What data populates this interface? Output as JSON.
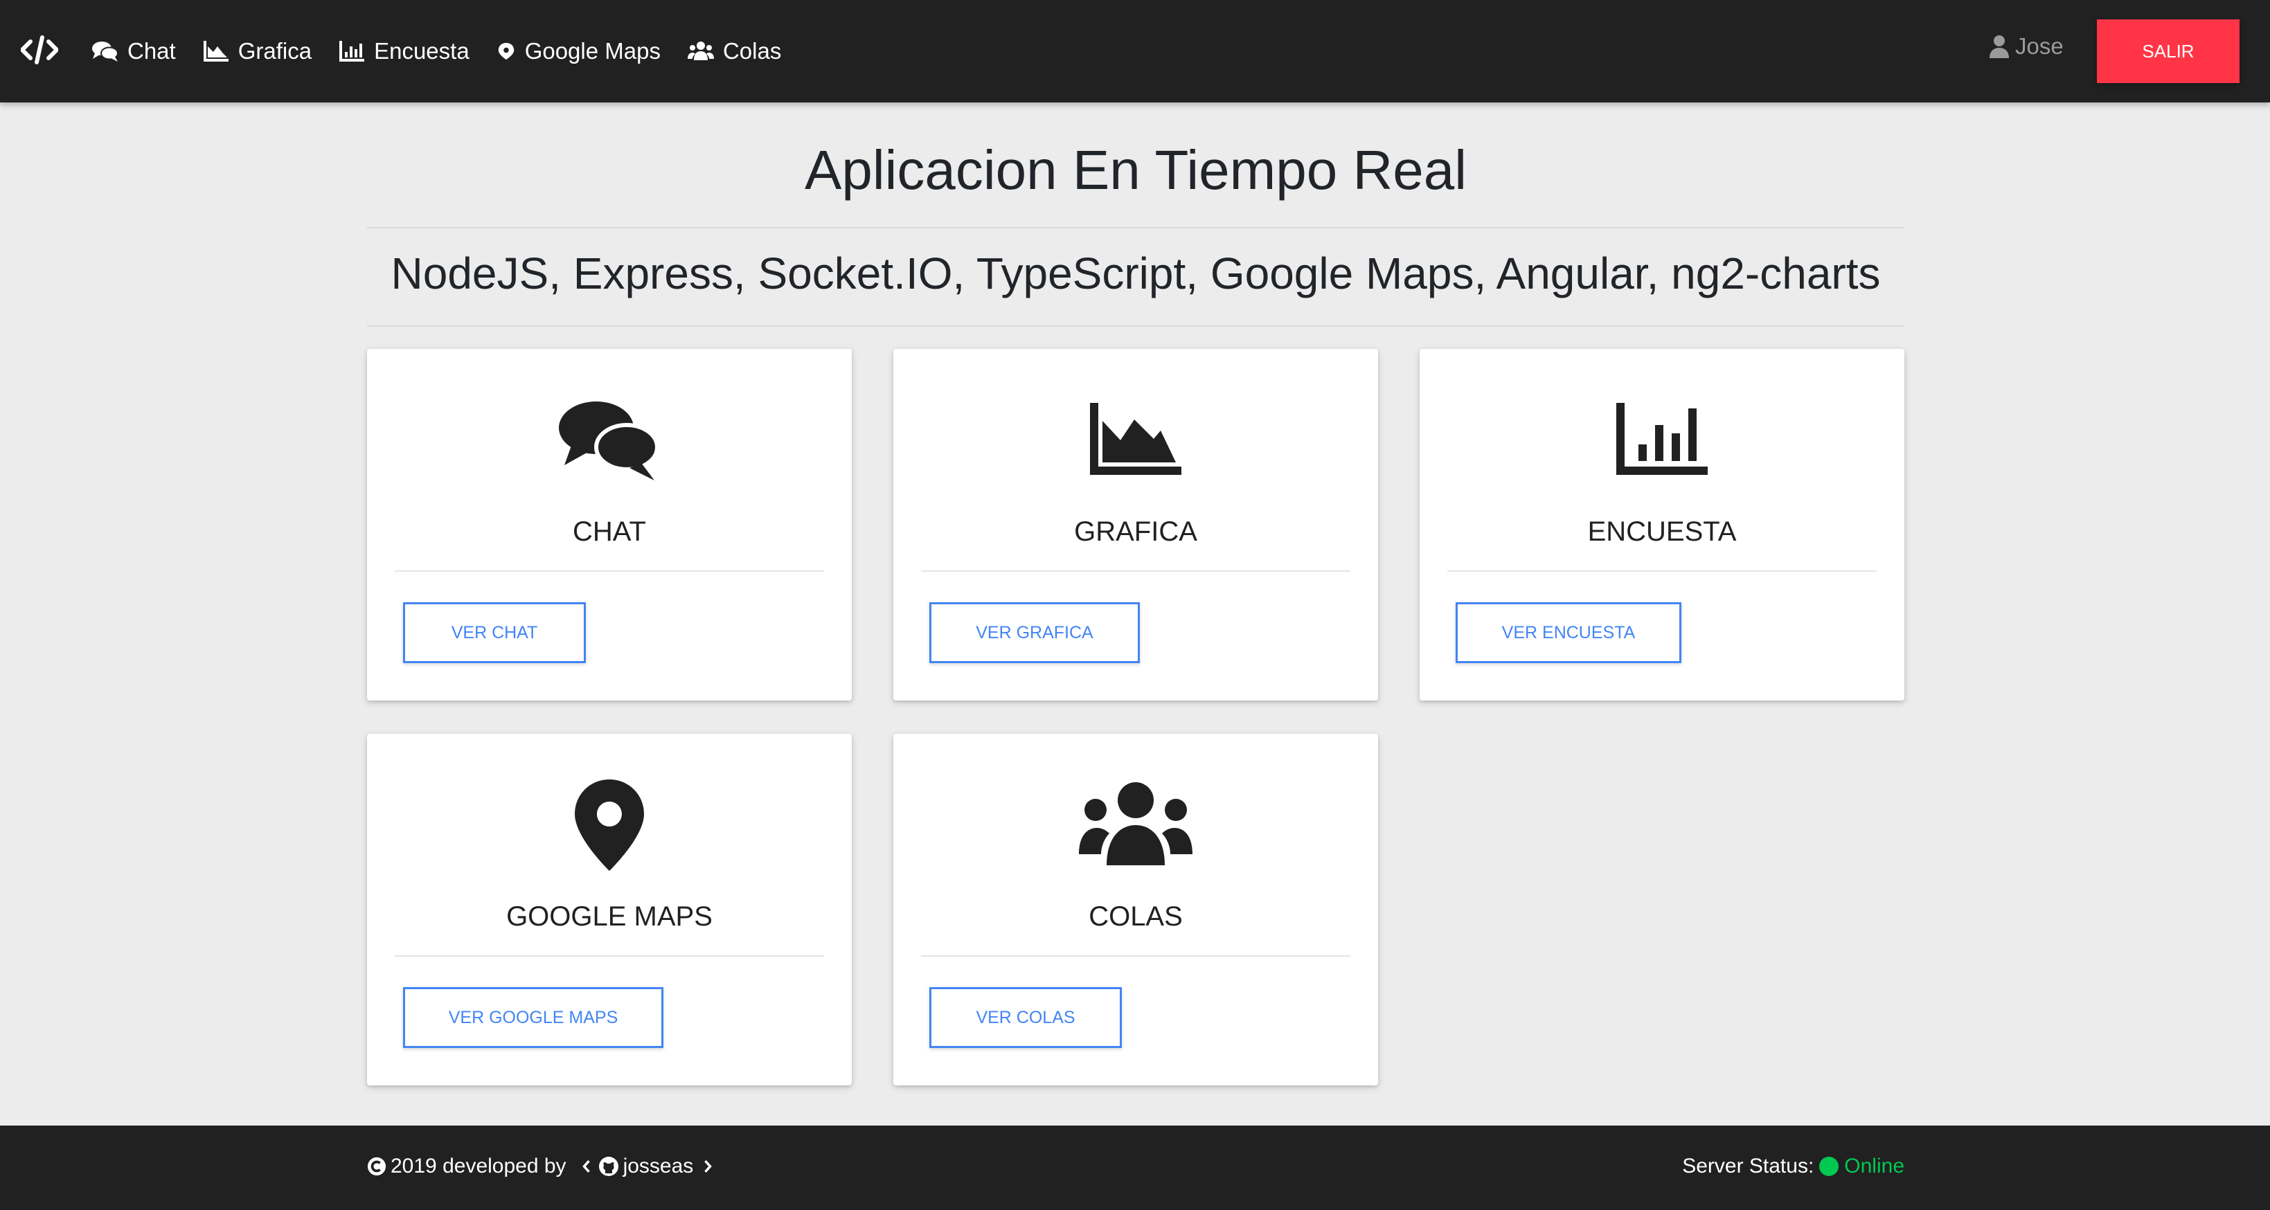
{
  "navbar": {
    "brand_icon": "code-icon",
    "links": [
      {
        "label": "Chat",
        "icon": "comments-icon"
      },
      {
        "label": "Grafica",
        "icon": "area-chart-icon"
      },
      {
        "label": "Encuesta",
        "icon": "bar-chart-icon"
      },
      {
        "label": "Google Maps",
        "icon": "map-marker-icon"
      },
      {
        "label": "Colas",
        "icon": "users-icon"
      }
    ],
    "user": "Jose",
    "logout_label": "SALIR"
  },
  "header": {
    "title": "Aplicacion En Tiempo Real",
    "subtitle": "NodeJS, Express, Socket.IO, TypeScript, Google Maps, Angular, ng2-charts"
  },
  "cards": [
    {
      "title": "CHAT",
      "button": "VER CHAT",
      "icon": "comments-icon"
    },
    {
      "title": "GRAFICA",
      "button": "VER GRAFICA",
      "icon": "area-chart-icon"
    },
    {
      "title": "ENCUESTA",
      "button": "VER ENCUESTA",
      "icon": "bar-chart-icon"
    },
    {
      "title": "GOOGLE MAPS",
      "button": "VER GOOGLE MAPS",
      "icon": "map-marker-icon"
    },
    {
      "title": "COLAS",
      "button": "VER COLAS",
      "icon": "users-icon"
    }
  ],
  "footer": {
    "copyright": "2019 developed by",
    "author": "josseas",
    "status_label": "Server Status:",
    "status_value": "Online"
  },
  "colors": {
    "navbar": "#212121",
    "logout": "#ff3547",
    "button_outline": "#4285f4",
    "online": "#00c851",
    "background": "#ececec"
  }
}
